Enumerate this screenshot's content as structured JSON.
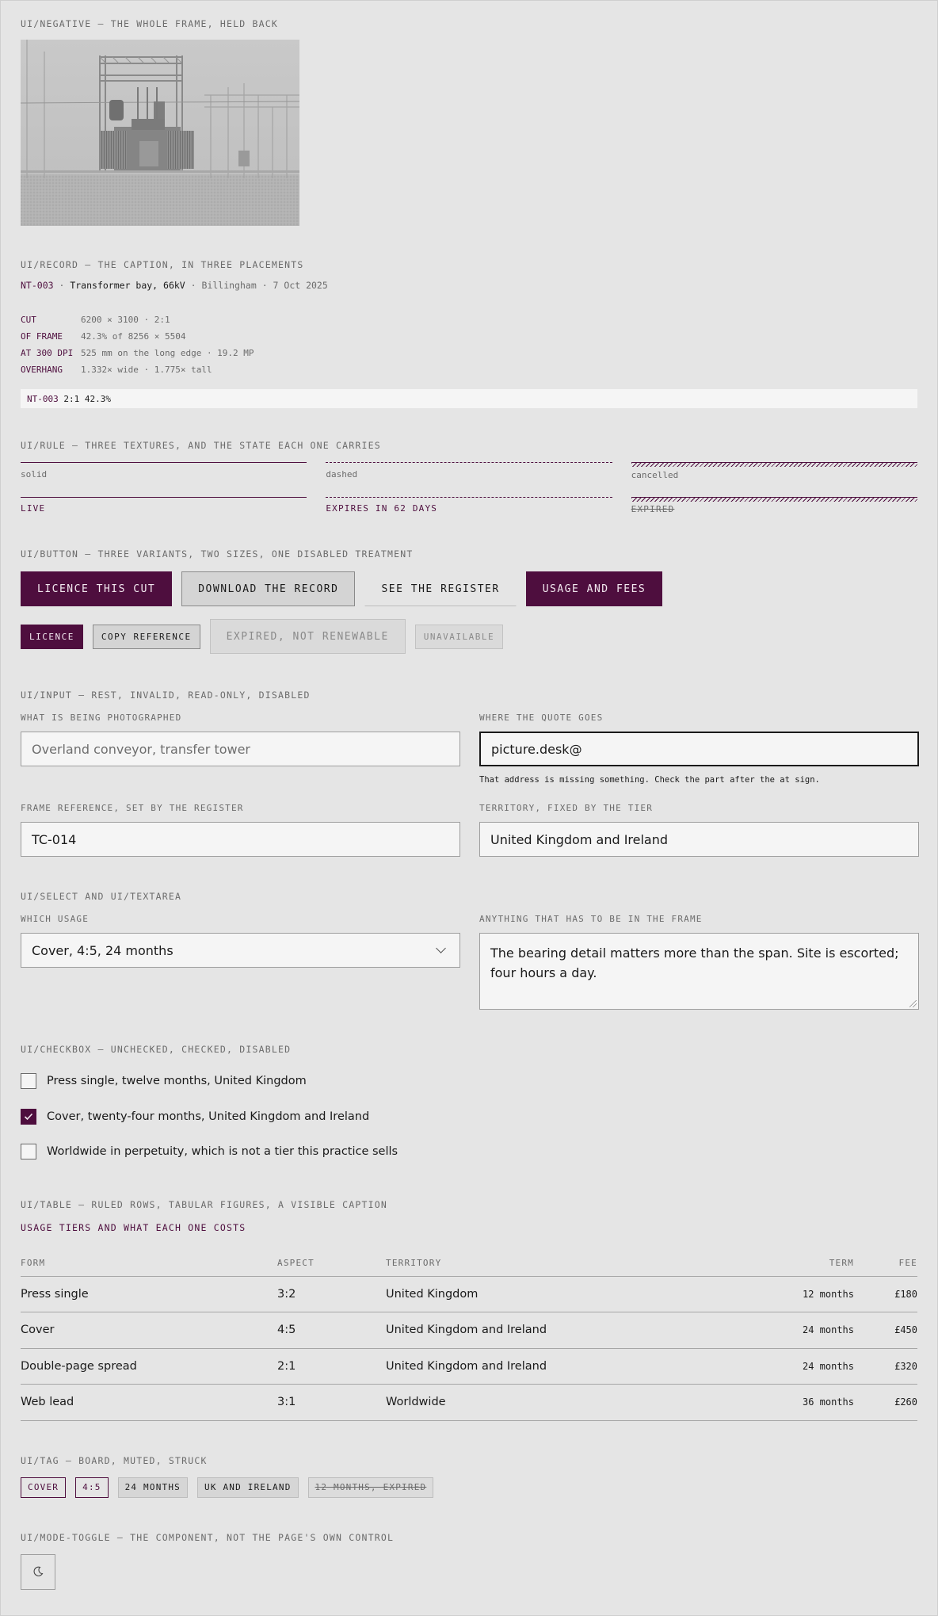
{
  "negative": {
    "label": "UI/NEGATIVE — THE WHOLE FRAME, HELD BACK"
  },
  "record": {
    "label": "UI/RECORD — THE CAPTION, IN THREE PLACEMENTS",
    "caption": {
      "ref": "NT-003",
      "sep1": " · ",
      "subject": "Transformer bay, 66kV",
      "sep2": " · ",
      "place": "Billingham",
      "sep3": " · ",
      "date": "7 Oct 2025"
    },
    "spec": [
      {
        "key": "CUT",
        "value": "6200 × 3100 · 2:1"
      },
      {
        "key": "OF FRAME",
        "value": "42.3% of 8256 × 5504"
      },
      {
        "key": "AT 300 DPI",
        "value": "525 mm on the long edge · 19.2 MP"
      },
      {
        "key": "OVERHANG",
        "value": "1.332× wide · 1.775× tall"
      }
    ],
    "strip": {
      "ref": "NT-003",
      "rest": " 2:1 42.3%"
    }
  },
  "rules": {
    "label": "UI/RULE — THREE TEXTURES, AND THE STATE EACH ONE CARRIES",
    "items": [
      {
        "name": "solid",
        "state": "LIVE"
      },
      {
        "name": "dashed",
        "state": "EXPIRES IN 62 DAYS"
      },
      {
        "name": "cancelled",
        "state": "EXPIRED"
      }
    ]
  },
  "buttons": {
    "label": "UI/BUTTON — THREE VARIANTS, TWO SIZES, ONE DISABLED TREATMENT",
    "large": [
      "LICENCE THIS CUT",
      "DOWNLOAD THE RECORD",
      "SEE THE REGISTER",
      "USAGE AND FEES"
    ],
    "small": [
      "LICENCE",
      "COPY REFERENCE",
      "EXPIRED, NOT RENEWABLE",
      "UNAVAILABLE"
    ]
  },
  "inputs": {
    "label": "UI/INPUT — REST, INVALID, READ-ONLY, DISABLED",
    "subject_label": "WHAT IS BEING PHOTOGRAPHED",
    "subject_placeholder": "Overland conveyor, transfer tower",
    "quote_label": "WHERE THE QUOTE GOES",
    "quote_value": "picture.desk@",
    "quote_error": "That address is missing something. Check the part after the at sign.",
    "ref_label": "FRAME REFERENCE, SET BY THE REGISTER",
    "ref_value": "TC-014",
    "territory_label": "TERRITORY, FIXED BY THE TIER",
    "territory_value": "United Kingdom and Ireland"
  },
  "select_textarea": {
    "label": "UI/SELECT AND UI/TEXTAREA",
    "usage_label": "WHICH USAGE",
    "usage_value": "Cover, 4:5, 24 months",
    "notes_label": "ANYTHING THAT HAS TO BE IN THE FRAME",
    "notes_value": "The bearing detail matters more than the span. Site is escorted; four hours a day."
  },
  "checkboxes": {
    "label": "UI/CHECKBOX — UNCHECKED, CHECKED, DISABLED",
    "items": [
      {
        "text": "Press single, twelve months, United Kingdom",
        "checked": false
      },
      {
        "text": "Cover, twenty-four months, United Kingdom and Ireland",
        "checked": true
      },
      {
        "text": "Worldwide in perpetuity, which is not a tier this practice sells",
        "checked": false
      }
    ]
  },
  "table": {
    "label": "UI/TABLE — RULED ROWS, TABULAR FIGURES, A VISIBLE CAPTION",
    "caption": "USAGE TIERS AND WHAT EACH ONE COSTS",
    "headers": [
      "FORM",
      "ASPECT",
      "TERRITORY",
      "TERM",
      "FEE"
    ],
    "rows": [
      [
        "Press single",
        "3:2",
        "United Kingdom",
        "12 months",
        "£180"
      ],
      [
        "Cover",
        "4:5",
        "United Kingdom and Ireland",
        "24 months",
        "£450"
      ],
      [
        "Double-page spread",
        "2:1",
        "United Kingdom and Ireland",
        "24 months",
        "£320"
      ],
      [
        "Web lead",
        "3:1",
        "Worldwide",
        "36 months",
        "£260"
      ]
    ]
  },
  "tags": {
    "label": "UI/TAG — BOARD, MUTED, STRUCK",
    "items": [
      "COVER",
      "4:5",
      "24 MONTHS",
      "UK AND IRELAND",
      "12 MONTHS, EXPIRED"
    ]
  },
  "mode_toggle": {
    "label": "UI/MODE-TOGGLE — THE COMPONENT, NOT THE PAGE'S OWN CONTROL",
    "icon": "moon-icon"
  },
  "colors": {
    "accent": "#4e0e3e",
    "background": "#e5e5e5",
    "field": "#f5f5f5"
  }
}
